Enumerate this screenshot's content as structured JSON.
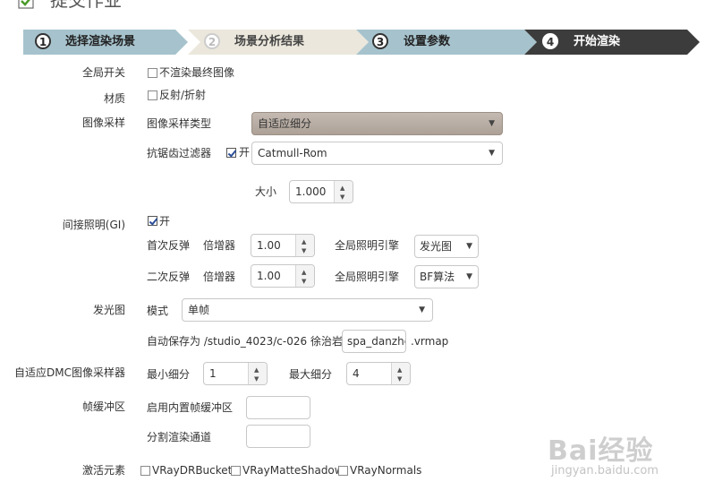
{
  "header": {
    "title": "提交作业"
  },
  "steps": [
    {
      "num": "1",
      "label": "选择渲染场景"
    },
    {
      "num": "2",
      "label": "场景分析结果"
    },
    {
      "num": "3",
      "label": "设置参数"
    },
    {
      "num": "4",
      "label": "开始渲染"
    }
  ],
  "global_switch": {
    "label": "全局开关",
    "option": "不渲染最终图像"
  },
  "material": {
    "label": "材质",
    "option": "反射/折射"
  },
  "image_sampler": {
    "label": "图像采样",
    "type_label": "图像采样类型",
    "type_value": "自适应细分",
    "aa_label": "抗锯齿过滤器",
    "aa_toggle": "开",
    "aa_value": "Catmull-Rom",
    "size_label": "大小",
    "size_value": "1.000"
  },
  "gi": {
    "label": "间接照明(GI)",
    "toggle": "开",
    "primary_label": "首次反弹",
    "secondary_label": "二次反弹",
    "multiplier_label": "倍增器",
    "primary_multiplier": "1.00",
    "secondary_multiplier": "1.00",
    "engine_label": "全局照明引擎",
    "primary_engine": "发光图",
    "secondary_engine": "BF算法"
  },
  "irradiance": {
    "label": "发光图",
    "mode_label": "模式",
    "mode_value": "单帧",
    "autosave_prefix": "自动保存为 /studio_4023/c-026 徐治岩/",
    "autosave_filename": "spa_danzhen",
    "autosave_ext": ".vrmap"
  },
  "dmc": {
    "label": "自适应DMC图像采样器",
    "min_label": "最小细分",
    "min_value": "1",
    "max_label": "最大细分",
    "max_value": "4"
  },
  "framebuffer": {
    "label": "帧缓冲区",
    "builtin_label": "启用内置帧缓冲区",
    "split_label": "分割渲染通道"
  },
  "elements": {
    "label": "激活元素",
    "items": [
      "VRayDRBucket",
      "VRayMatteShadow",
      "VRayNormals"
    ]
  },
  "watermark": {
    "brand": "Bai经验",
    "url": "jingyan.baidu.com"
  }
}
